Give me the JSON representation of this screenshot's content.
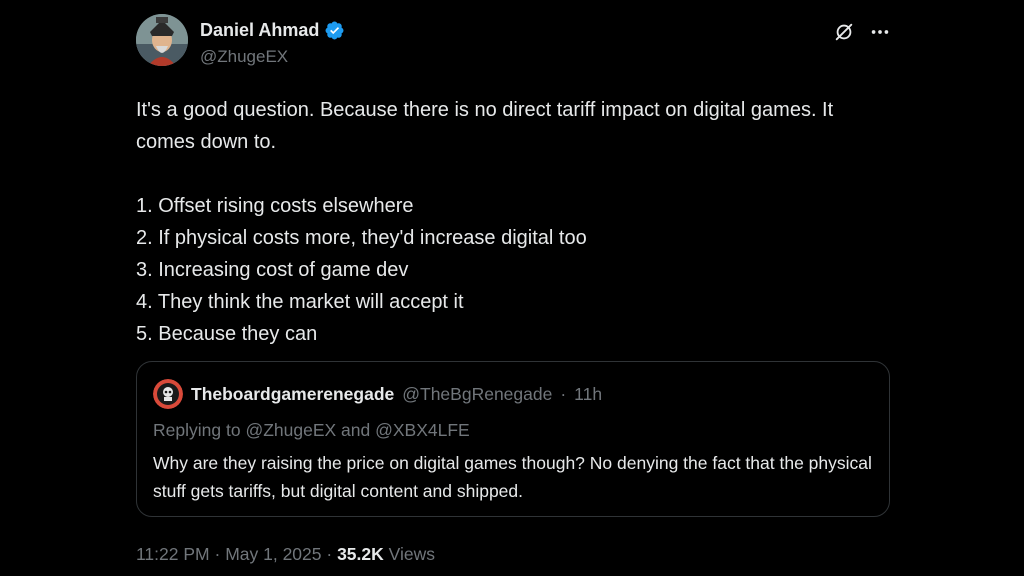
{
  "author": {
    "display_name": "Daniel Ahmad",
    "handle": "@ZhugeEX",
    "verified": true
  },
  "icons": {
    "verified": "verified-badge-icon",
    "grok": "grok-slash-icon",
    "more": "more-horizontal-icon"
  },
  "colors": {
    "background": "#000000",
    "text": "#e7e9ea",
    "secondary": "#71767b",
    "verified": "#1d9bf0",
    "border": "#2f3336"
  },
  "tweet": {
    "intro": "It's a good question. Because there is no direct tariff impact on digital games. It comes down to.",
    "points": [
      "1. Offset rising costs elsewhere",
      "2. If physical costs more, they'd increase digital too",
      "3. Increasing cost of game dev",
      "4. They think the market will accept it",
      "5. Because they can"
    ]
  },
  "quote": {
    "display_name": "Theboardgamerenegade",
    "handle": "@TheBgRenegade",
    "time": "11h",
    "replying_prefix": "Replying to",
    "replying_mention_1": "@ZhugeEX",
    "replying_and": "and",
    "replying_mention_2": "@XBX4LFE",
    "text": "Why are they raising the price on digital games though? No denying the fact that the physical stuff gets tariffs, but digital content and shipped."
  },
  "footer": {
    "time": "11:22 PM",
    "date": "May 1, 2025",
    "views_count": "35.2K",
    "views_label": "Views"
  }
}
